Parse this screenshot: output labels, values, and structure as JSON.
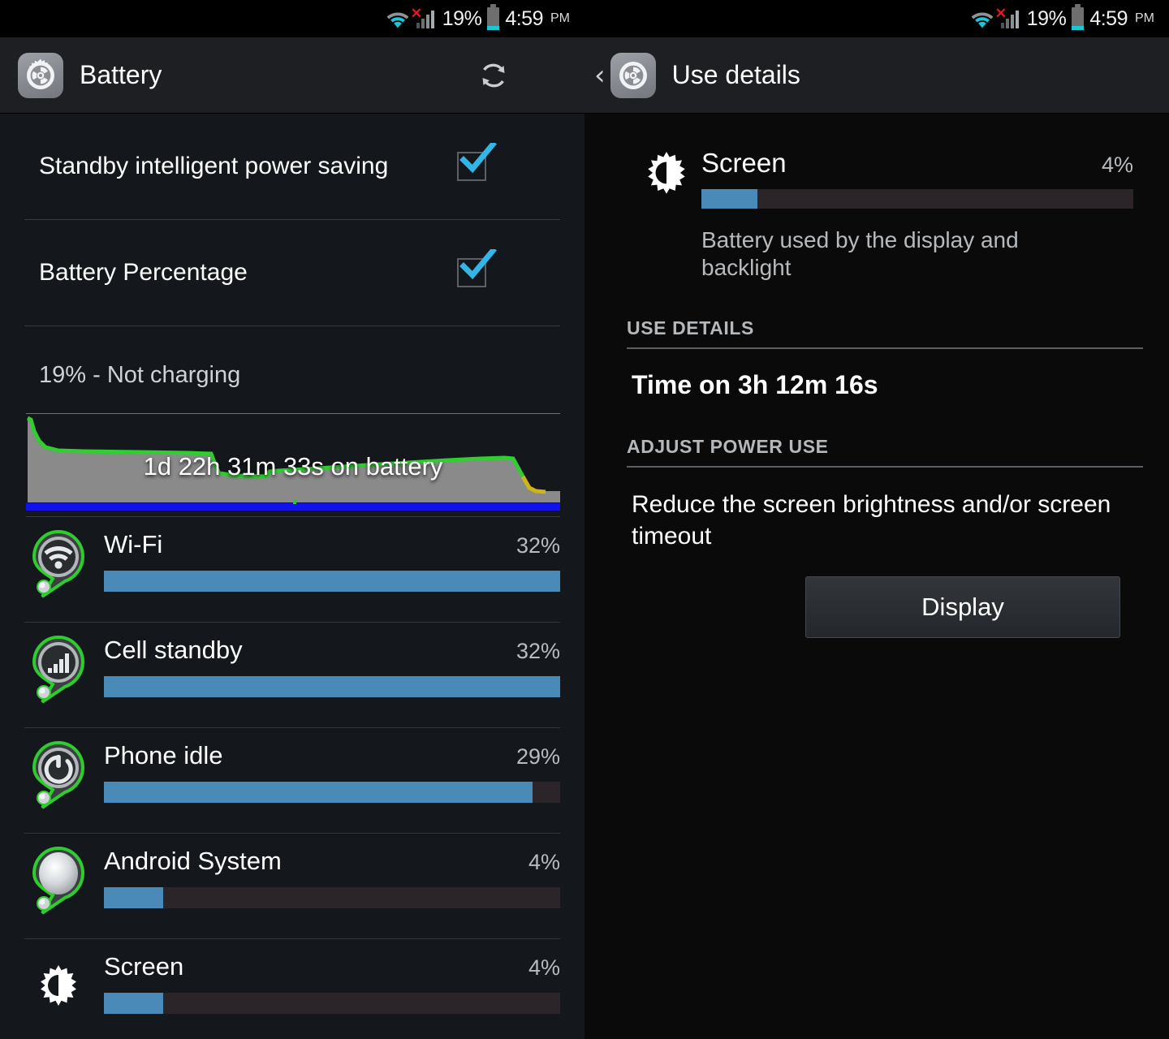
{
  "status_bar": {
    "battery_percent": "19%",
    "time": "4:59",
    "meridiem": "PM",
    "wifi_icon": "wifi-icon",
    "signal_icon": "cell-signal-icon",
    "no_service_marker": "×",
    "battery_icon": "battery-icon"
  },
  "left_pane": {
    "app_icon": "settings-gear-icon",
    "title": "Battery",
    "refresh_icon": "refresh-icon",
    "toggles": [
      {
        "label": "Standby intelligent power saving",
        "checked": true
      },
      {
        "label": "Battery Percentage",
        "checked": true
      }
    ],
    "battery_status": "19% - Not charging",
    "graph_overlay_text": "1d 22h 31m 33s on battery",
    "usage_items": [
      {
        "name": "Wi-Fi",
        "percent": "32%",
        "value": 100,
        "icon": "wifi-drop-icon"
      },
      {
        "name": "Cell standby",
        "percent": "32%",
        "value": 100,
        "icon": "signal-drop-icon"
      },
      {
        "name": "Phone idle",
        "percent": "29%",
        "value": 94,
        "icon": "power-drop-icon"
      },
      {
        "name": "Android System",
        "percent": "4%",
        "value": 13,
        "icon": "android-drop-icon"
      },
      {
        "name": "Screen",
        "percent": "4%",
        "value": 13,
        "icon": "brightness-icon"
      }
    ]
  },
  "right_pane": {
    "back_chevron": "‹",
    "app_icon": "settings-gear-icon",
    "title": "Use details",
    "detail": {
      "icon": "brightness-icon",
      "name": "Screen",
      "percent": "4%",
      "value": 13,
      "description": "Battery used by the display and backlight"
    },
    "use_details_header": "USE DETAILS",
    "time_on": "Time on 3h 12m 16s",
    "adjust_header": "ADJUST POWER USE",
    "adjust_text": "Reduce the screen brightness and/or screen timeout",
    "display_button": "Display"
  },
  "colors": {
    "accent_bar": "#4a8ab8",
    "bar_track": "#2b2428",
    "checkbox_tick": "#33b5e5",
    "graph_line": "#33cc33",
    "graph_fill": "#8a8a8a",
    "graph_blue": "#1212ec",
    "status_cyan": "#17c8d8",
    "status_red": "#e01b1b"
  }
}
